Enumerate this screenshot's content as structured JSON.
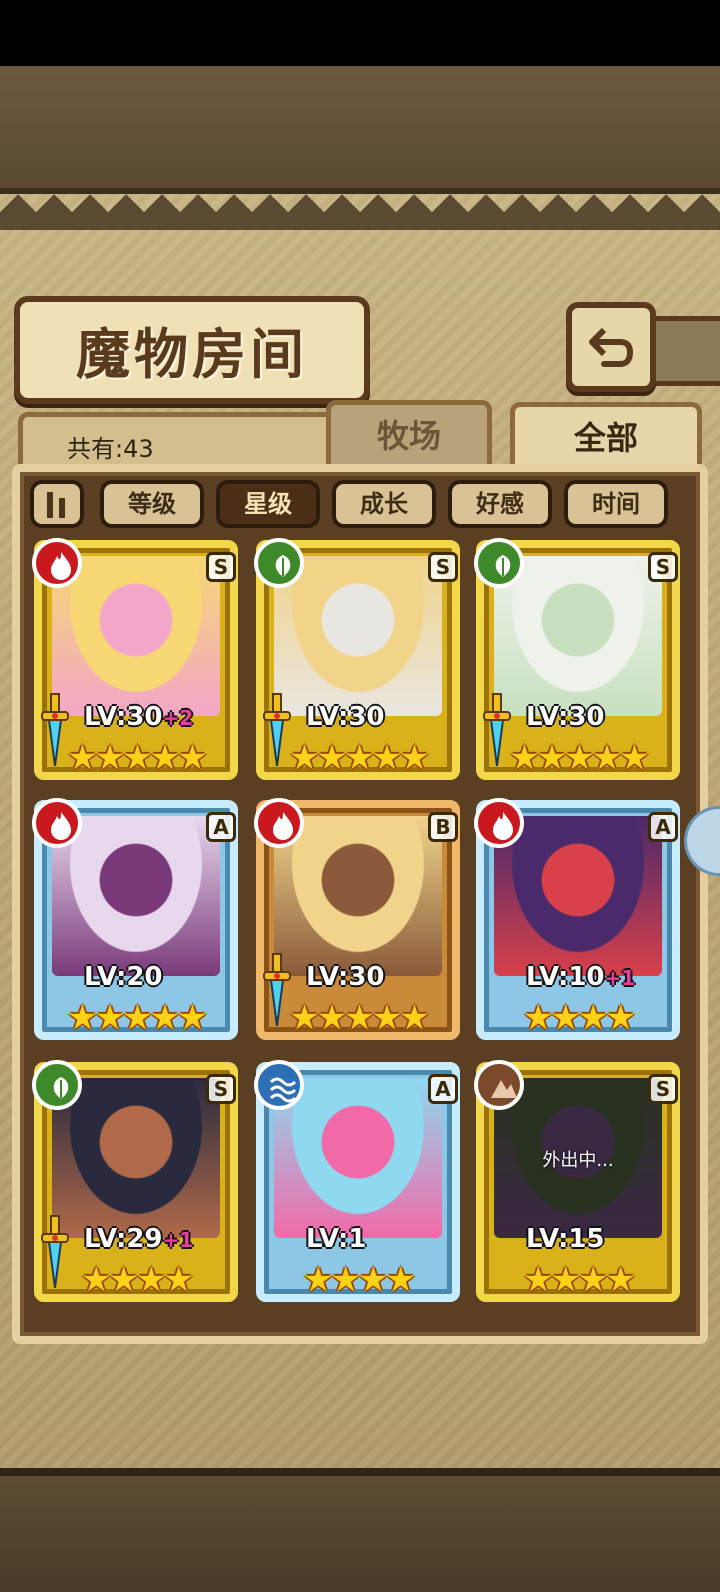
{
  "title": "魔物房间",
  "count_text": "共有:43",
  "tabs": [
    {
      "label": "牧场",
      "active": false
    },
    {
      "label": "全部",
      "active": true
    }
  ],
  "sort_buttons": [
    {
      "label": "等级",
      "active": false
    },
    {
      "label": "星级",
      "active": true
    },
    {
      "label": "成长",
      "active": false
    },
    {
      "label": "好感",
      "active": false
    },
    {
      "label": "时间",
      "active": false
    }
  ],
  "cards": [
    {
      "element": "fire",
      "rank": "S",
      "frame": "gold",
      "level": "LV:30",
      "bonus": "+2",
      "stars": 5,
      "weapon": true,
      "away": "",
      "palette": [
        "#f6d774",
        "#f3a6c8"
      ]
    },
    {
      "element": "leaf",
      "rank": "S",
      "frame": "gold",
      "level": "LV:30",
      "bonus": "",
      "stars": 5,
      "weapon": true,
      "away": "",
      "palette": [
        "#f1d48a",
        "#e8e6e0"
      ]
    },
    {
      "element": "leaf",
      "rank": "S",
      "frame": "gold",
      "level": "LV:30",
      "bonus": "",
      "stars": 5,
      "weapon": true,
      "away": "",
      "palette": [
        "#eef2ea",
        "#c8e0c0"
      ]
    },
    {
      "element": "fire",
      "rank": "A",
      "frame": "blue",
      "level": "LV:20",
      "bonus": "",
      "stars": 5,
      "weapon": false,
      "away": "",
      "palette": [
        "#e8d8ee",
        "#7a3a7a"
      ]
    },
    {
      "element": "fire",
      "rank": "B",
      "frame": "bronze",
      "level": "LV:30",
      "bonus": "",
      "stars": 5,
      "weapon": true,
      "away": "",
      "palette": [
        "#f0d48c",
        "#8a5a3a"
      ]
    },
    {
      "element": "fire",
      "rank": "A",
      "frame": "blue",
      "level": "LV:10",
      "bonus": "+1",
      "stars": 4,
      "weapon": false,
      "away": "",
      "palette": [
        "#4a2a6a",
        "#d8404a"
      ]
    },
    {
      "element": "leaf",
      "rank": "S",
      "frame": "gold",
      "level": "LV:29",
      "bonus": "+1",
      "stars": 4,
      "weapon": true,
      "away": "",
      "palette": [
        "#2a2a3e",
        "#b06a4a"
      ]
    },
    {
      "element": "water",
      "rank": "A",
      "frame": "blue",
      "level": "LV:1",
      "bonus": "",
      "stars": 4,
      "weapon": false,
      "away": "",
      "palette": [
        "#8ed8f0",
        "#f26aa8"
      ]
    },
    {
      "element": "earth",
      "rank": "S",
      "frame": "gold",
      "level": "LV:15",
      "bonus": "",
      "stars": 4,
      "weapon": false,
      "away": "外出中...",
      "palette": [
        "#4a5a3a",
        "#6a4a7a"
      ]
    }
  ],
  "colors": {
    "parchment": "#c9b685",
    "panel": "#5a3f22",
    "accent": "#4a2f16"
  }
}
